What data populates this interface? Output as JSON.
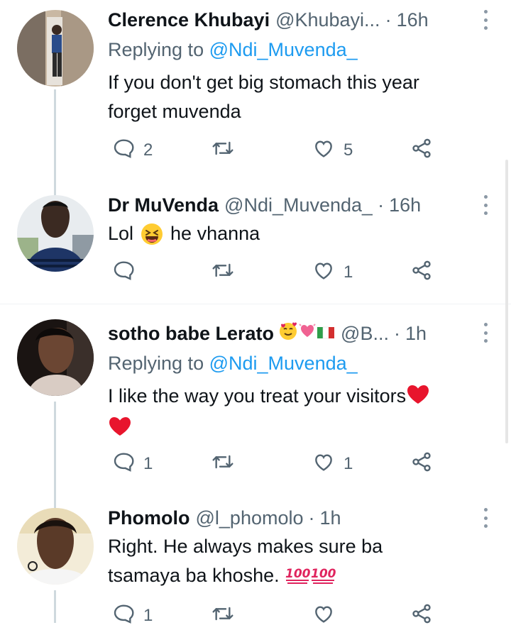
{
  "tweets": [
    {
      "name": "Clerence Khubayi",
      "handle": "@Khubayi...",
      "dot": "·",
      "time": "16h",
      "replying_prefix": "Replying to",
      "replying_to": "@Ndi_Muvenda_",
      "text": "If you don't get big stomach this year forget muvenda",
      "replies": "2",
      "retweets": "",
      "likes": "5"
    },
    {
      "name": "Dr MuVenda",
      "handle": "@Ndi_Muvenda_",
      "dot": "·",
      "time": "16h",
      "text_before_emoji": "Lol",
      "text_after_emoji": "he vhanna",
      "emoji": "grinning-squinting-face",
      "replies": "",
      "retweets": "",
      "likes": "1"
    },
    {
      "name": "sotho babe Lerato",
      "name_emojis": [
        "smiling-face-with-hearts",
        "sparkling-heart",
        "flag-italy"
      ],
      "handle": "@B...",
      "dot": "·",
      "time": "1h",
      "replying_prefix": "Replying to",
      "replying_to": "@Ndi_Muvenda_",
      "text": "I like the way you treat your visitors",
      "text_emojis": [
        "red-heart",
        "red-heart"
      ],
      "replies": "1",
      "retweets": "",
      "likes": "1"
    },
    {
      "name": "Phomolo",
      "handle": "@l_phomolo",
      "dot": "·",
      "time": "1h",
      "text": "Right. He always makes sure ba tsamaya ba khoshe.",
      "text_emojis": [
        "hundred-points",
        "hundred-points"
      ],
      "replies": "1",
      "retweets": "",
      "likes": ""
    }
  ],
  "colors": {
    "text": "#0f1419",
    "secondary": "#536471",
    "link": "#1d9bf0",
    "thread_line": "#cfd9de",
    "divider": "#eff3f4"
  }
}
